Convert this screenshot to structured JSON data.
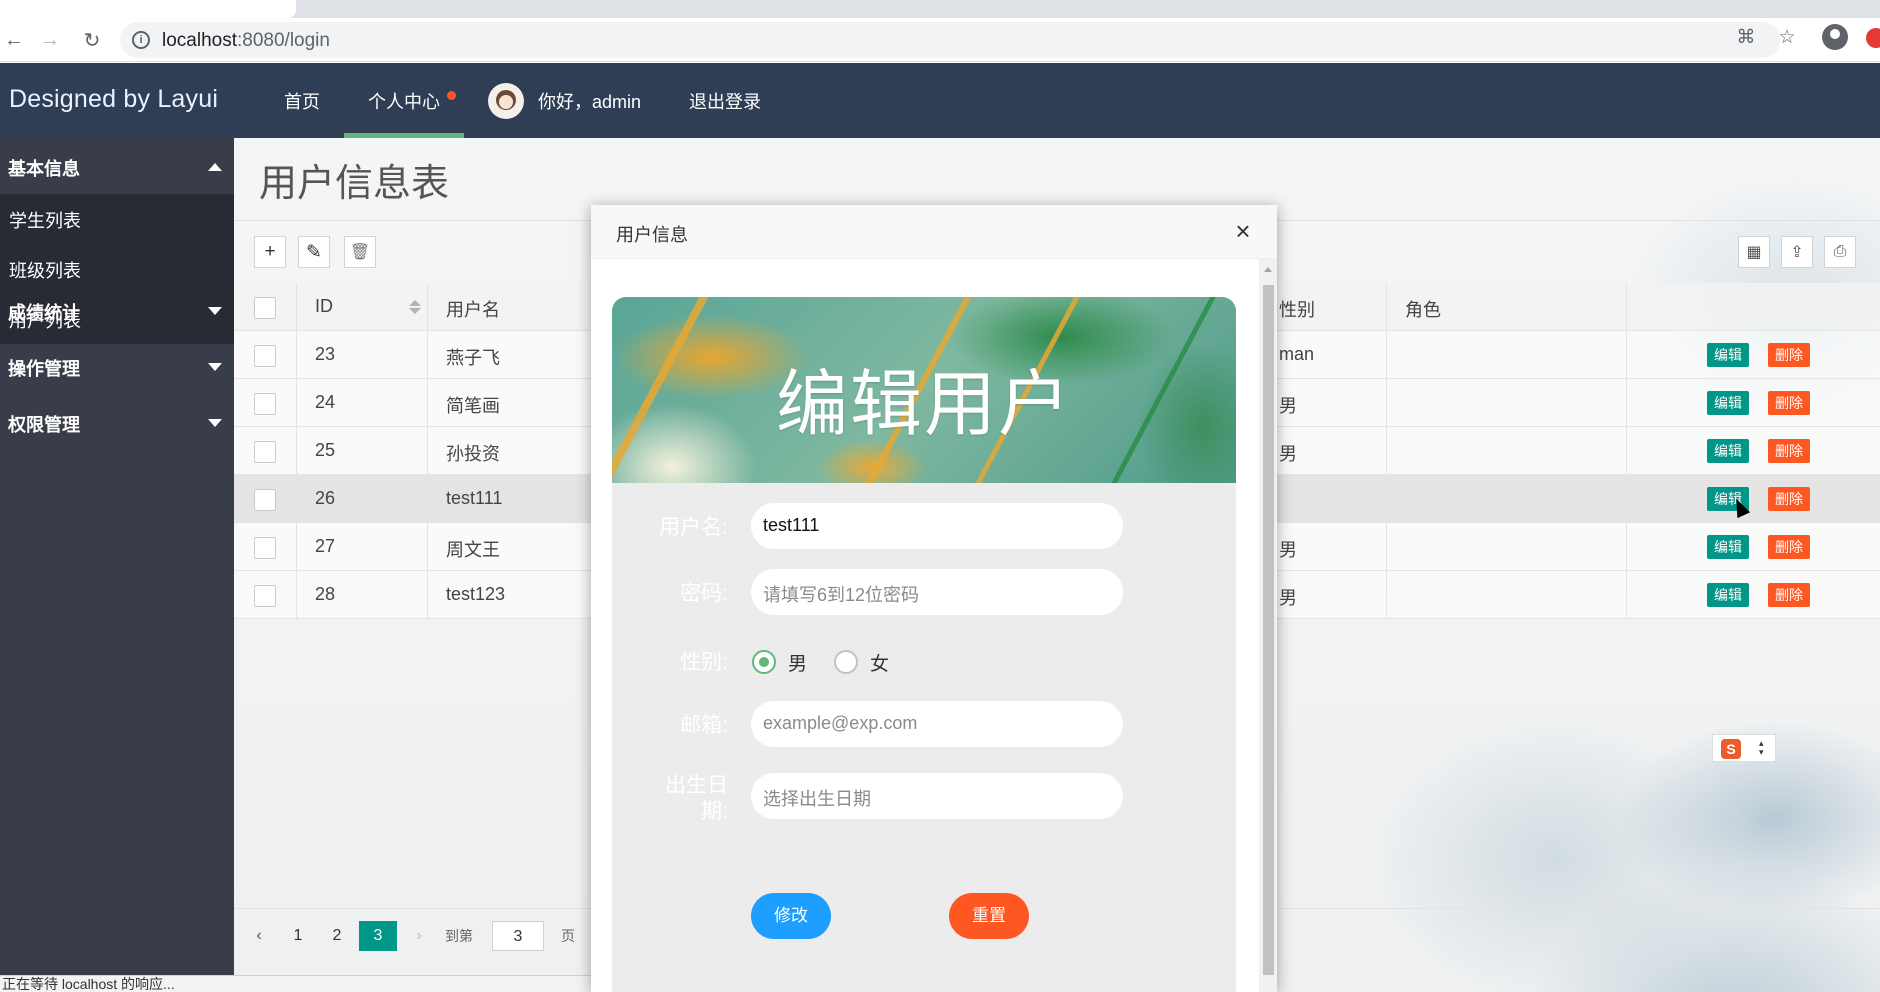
{
  "browser": {
    "url": "localhost:8080/login",
    "url_host": "localhost",
    "url_rest": ":8080/login"
  },
  "sidebar": {
    "logo": "Designed by Layui",
    "sections": [
      {
        "label": "基本信息",
        "expanded": true,
        "items": [
          "学生列表",
          "班级列表",
          "用户列表"
        ]
      },
      {
        "label": "成绩统计",
        "expanded": false
      },
      {
        "label": "操作管理",
        "expanded": false
      },
      {
        "label": "权限管理",
        "expanded": false
      }
    ]
  },
  "topnav": {
    "home": "首页",
    "personal": "个人中心",
    "greeting": "你好，admin",
    "logout": "退出登录"
  },
  "page": {
    "title": "用户信息表"
  },
  "table": {
    "columns": [
      "ID",
      "用户名",
      "性别",
      "角色"
    ],
    "rows": [
      {
        "id": "23",
        "username": "燕子飞",
        "gender": "man"
      },
      {
        "id": "24",
        "username": "简笔画",
        "gender": "男"
      },
      {
        "id": "25",
        "username": "孙投资",
        "gender": "男"
      },
      {
        "id": "26",
        "username": "test111",
        "gender": ""
      },
      {
        "id": "27",
        "username": "周文王",
        "gender": "男"
      },
      {
        "id": "28",
        "username": "test123",
        "gender": "男"
      }
    ],
    "edit_label": "编辑",
    "delete_label": "删除"
  },
  "pager": {
    "pages": [
      "1",
      "2",
      "3"
    ],
    "current": "3",
    "goto_prefix": "到第",
    "goto_value": "3",
    "goto_suffix": "页"
  },
  "status_text": "正在等待 localhost 的响应...",
  "modal": {
    "title": "用户信息",
    "banner": "编辑用户",
    "fields": {
      "username_label": "用户名:",
      "username_value": "test111",
      "password_label": "密码:",
      "password_placeholder": "请填写6到12位密码",
      "gender_label": "性别:",
      "gender_male": "男",
      "gender_female": "女",
      "gender_selected": "男",
      "email_label": "邮箱:",
      "email_placeholder": "example@exp.com",
      "birth_label": "出生日期:",
      "birth_placeholder": "选择出生日期"
    },
    "submit": "修改",
    "reset": "重置"
  },
  "colors": {
    "primary_green": "#009688",
    "danger": "#ff5722",
    "nav_dark": "#393d49",
    "header": "#2f3d55",
    "accent_blue": "#1e9fff"
  }
}
